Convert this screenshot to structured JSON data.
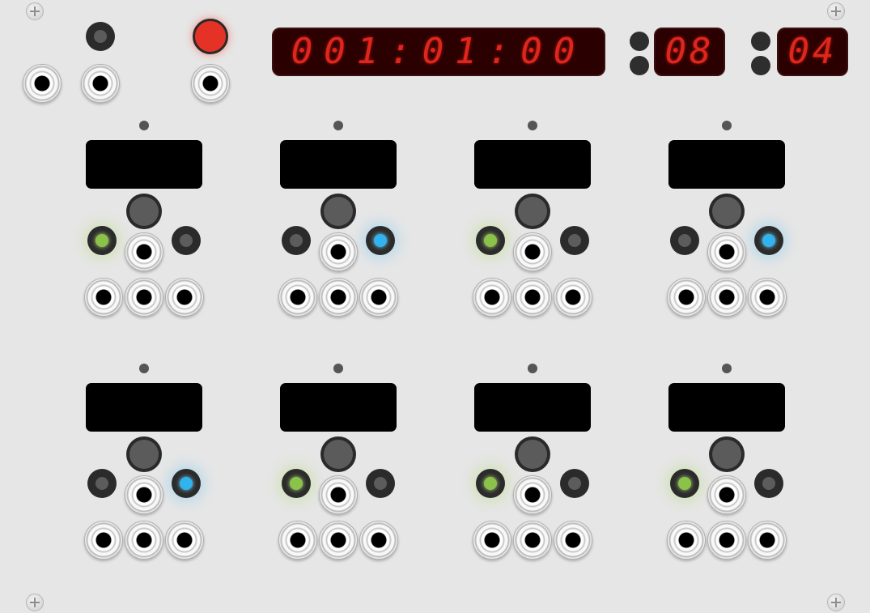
{
  "display": {
    "time": "001:01:00",
    "value_a": "08",
    "value_b": "04"
  },
  "channels": [
    {
      "left_lit": "green",
      "right_lit": "none"
    },
    {
      "left_lit": "none",
      "right_lit": "blue"
    },
    {
      "left_lit": "green",
      "right_lit": "none"
    },
    {
      "left_lit": "none",
      "right_lit": "blue"
    },
    {
      "left_lit": "none",
      "right_lit": "blue"
    },
    {
      "left_lit": "green",
      "right_lit": "none"
    },
    {
      "left_lit": "green",
      "right_lit": "none"
    },
    {
      "left_lit": "green",
      "right_lit": "none"
    }
  ],
  "colors": {
    "panel": "#e6e6e6",
    "segment_red": "#e0261c",
    "led_green": "#8bc34a",
    "led_blue": "#2fb4ee",
    "record_red": "#e53227"
  },
  "icons": [
    "screw-icon",
    "jack-icon",
    "record-button-icon"
  ]
}
